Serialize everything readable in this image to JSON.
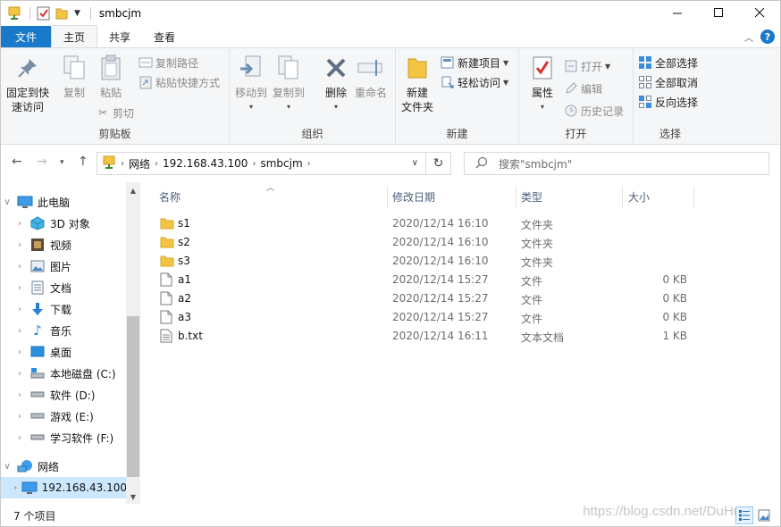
{
  "window": {
    "title": "smbcjm"
  },
  "ribbon_tabs": [
    {
      "label": "文件"
    },
    {
      "label": "主页"
    },
    {
      "label": "共享"
    },
    {
      "label": "查看"
    }
  ],
  "ribbon": {
    "clipboard": {
      "group_label": "剪贴板",
      "pin_label_1": "固定到快",
      "pin_label_2": "速访问",
      "copy_label": "复制",
      "paste_label": "粘贴",
      "copy_path_label": "复制路径",
      "paste_shortcut_label": "粘贴快捷方式",
      "cut_label": "剪切"
    },
    "organize": {
      "group_label": "组织",
      "move_to_label": "移动到",
      "copy_to_label": "复制到",
      "delete_label": "删除",
      "rename_label": "重命名"
    },
    "new": {
      "group_label": "新建",
      "new_folder_label_1": "新建",
      "new_folder_label_2": "文件夹",
      "new_item_label": "新建项目",
      "easy_access_label": "轻松访问"
    },
    "open": {
      "group_label": "打开",
      "properties_label": "属性",
      "open_label": "打开",
      "edit_label": "编辑",
      "history_label": "历史记录"
    },
    "select": {
      "group_label": "选择",
      "select_all_label": "全部选择",
      "select_none_label": "全部取消",
      "invert_label": "反向选择"
    }
  },
  "address": {
    "crumbs": [
      "网络",
      "192.168.43.100",
      "smbcjm"
    ],
    "search_placeholder": "搜索\"smbcjm\""
  },
  "nav_pane": {
    "items": [
      {
        "label": "此电脑",
        "icon": "computer-icon"
      },
      {
        "label": "3D 对象",
        "icon": "3d-objects-icon"
      },
      {
        "label": "视频",
        "icon": "video-icon"
      },
      {
        "label": "图片",
        "icon": "pictures-icon"
      },
      {
        "label": "文档",
        "icon": "documents-icon"
      },
      {
        "label": "下载",
        "icon": "download-icon"
      },
      {
        "label": "音乐",
        "icon": "music-icon"
      },
      {
        "label": "桌面",
        "icon": "desktop-icon"
      },
      {
        "label": "本地磁盘 (C:)",
        "icon": "system-drive-icon"
      },
      {
        "label": "软件 (D:)",
        "icon": "drive-icon"
      },
      {
        "label": "游戏 (E:)",
        "icon": "drive-icon"
      },
      {
        "label": "学习软件 (F:)",
        "icon": "drive-icon"
      },
      {
        "label": "网络",
        "icon": "network-icon"
      },
      {
        "label": "192.168.43.100",
        "icon": "network-computer-icon"
      }
    ]
  },
  "file_list": {
    "columns": {
      "name": "名称",
      "date": "修改日期",
      "type": "类型",
      "size": "大小"
    },
    "rows": [
      {
        "name": "s1",
        "date": "2020/12/14 16:10",
        "type": "文件夹",
        "size": "",
        "icon": "folder-icon"
      },
      {
        "name": "s2",
        "date": "2020/12/14 16:10",
        "type": "文件夹",
        "size": "",
        "icon": "folder-icon"
      },
      {
        "name": "s3",
        "date": "2020/12/14 16:10",
        "type": "文件夹",
        "size": "",
        "icon": "folder-icon"
      },
      {
        "name": "a1",
        "date": "2020/12/14 15:27",
        "type": "文件",
        "size": "0 KB",
        "icon": "file-icon"
      },
      {
        "name": "a2",
        "date": "2020/12/14 15:27",
        "type": "文件",
        "size": "0 KB",
        "icon": "file-icon"
      },
      {
        "name": "a3",
        "date": "2020/12/14 15:27",
        "type": "文件",
        "size": "0 KB",
        "icon": "file-icon"
      },
      {
        "name": "b.txt",
        "date": "2020/12/14 16:11",
        "type": "文本文档",
        "size": "1 KB",
        "icon": "text-file-icon"
      }
    ]
  },
  "status": {
    "item_count": "7 个项目"
  },
  "watermark": "https://blog.csdn.net/DuHu",
  "colors": {
    "accent": "#1979ca",
    "folder": "#f4c542",
    "selection": "#cce8ff"
  }
}
